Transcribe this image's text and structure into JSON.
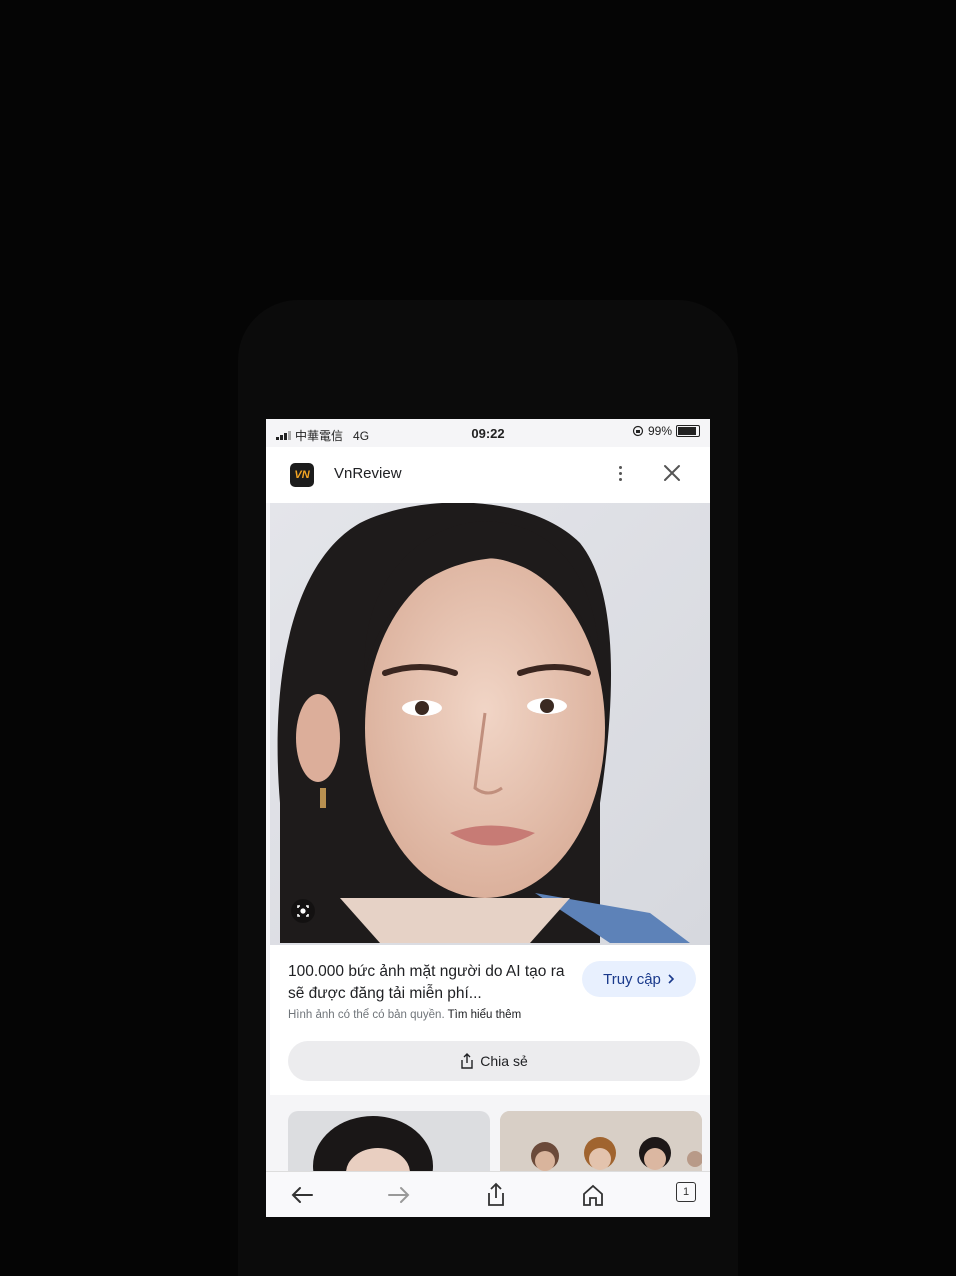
{
  "status_bar": {
    "carrier": "中華電信",
    "network": "4G",
    "time": "09:22",
    "battery": "99%"
  },
  "header": {
    "logo_text": "VN",
    "site_name": "VnReview"
  },
  "result": {
    "title": "100.000 bức ảnh mặt người do AI tạo ra sẽ được đăng tải miễn phí...",
    "source_note": "Hình ảnh có thể có bản quyền.",
    "learn_more": "Tìm hiểu thêm",
    "visit_label": "Truy cập",
    "share_label": "Chia sẻ"
  },
  "toolbar": {
    "tabs_count": "1"
  },
  "icons": [
    "back-icon",
    "forward-icon",
    "share-icon",
    "home-icon",
    "tabs-icon",
    "more-icon",
    "close-icon",
    "lens-icon",
    "chevron-right-icon"
  ],
  "colors": {
    "visit_bg": "#e8f0fe",
    "visit_text": "#1a3a8c",
    "logo_accent": "#f5a623"
  }
}
